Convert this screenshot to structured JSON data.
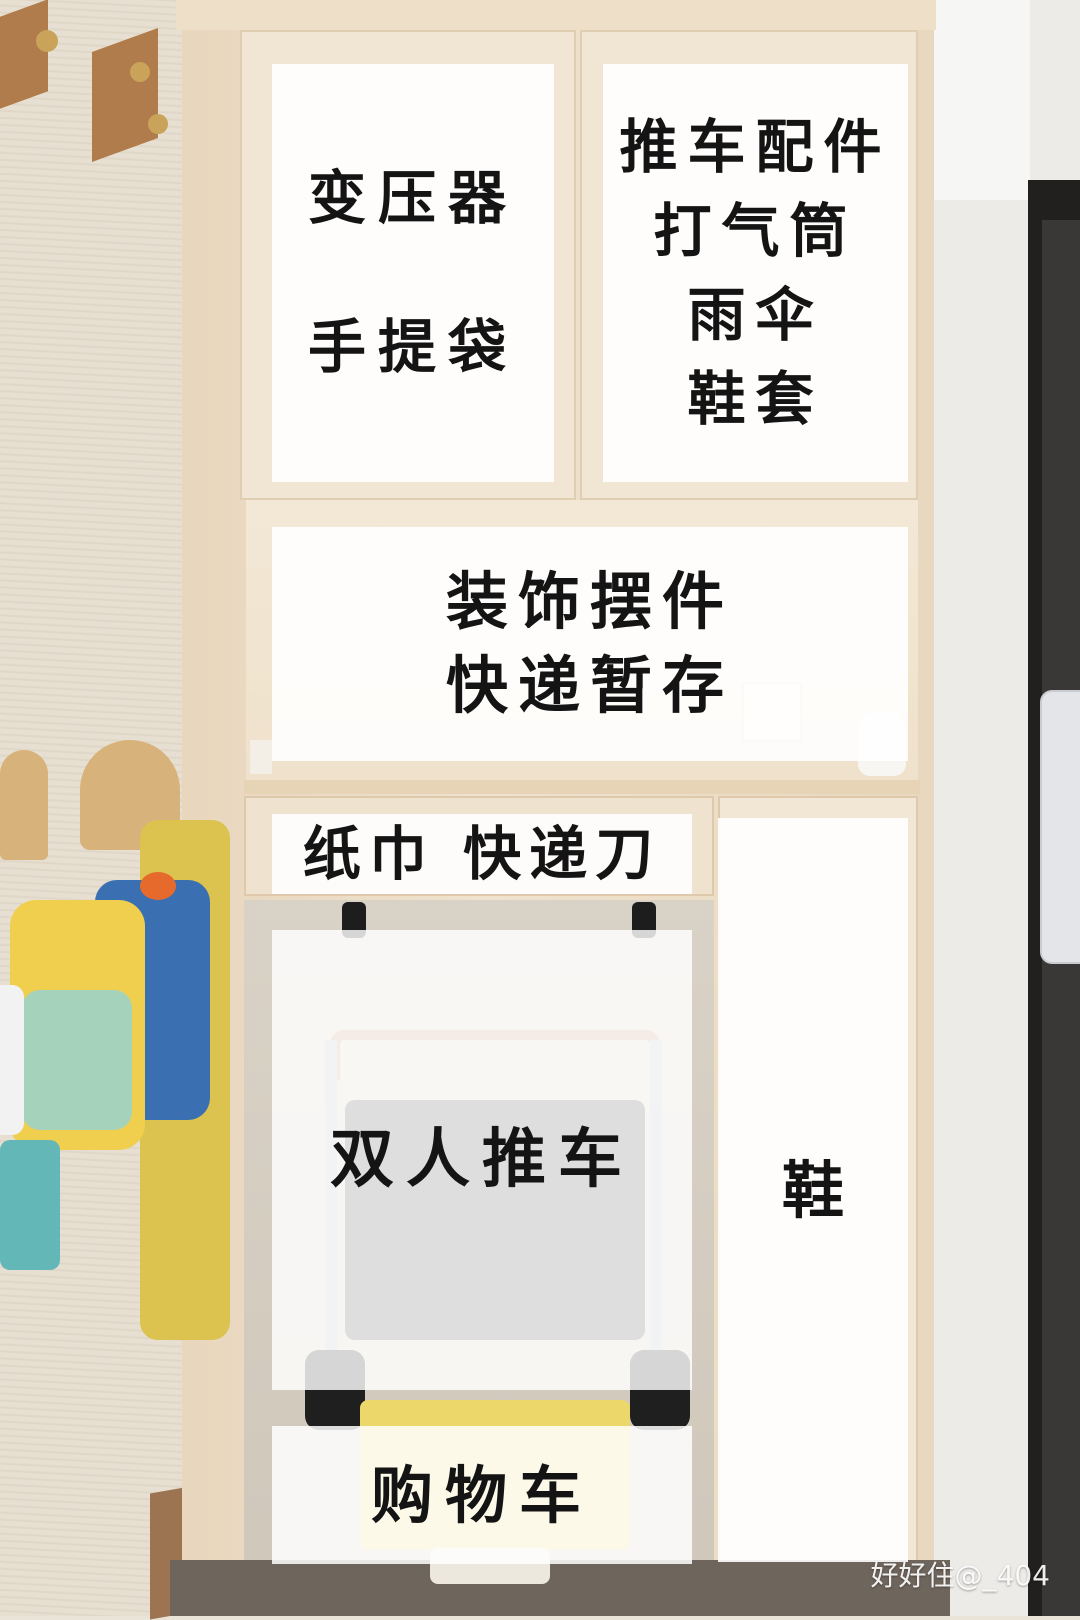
{
  "labels": {
    "upper_left": {
      "line1": "变压器",
      "line2": "手提袋"
    },
    "upper_right": {
      "line1": "推车配件",
      "line2": "打气筒",
      "line3": "雨伞",
      "line4": "鞋套"
    },
    "niche": {
      "line1": "装饰摆件",
      "line2": "快递暂存"
    },
    "drawer": {
      "text": "纸巾 快递刀"
    },
    "stroller_bay": {
      "text": "双人推车"
    },
    "shoe_cabinet": {
      "text": "鞋"
    },
    "bottom": {
      "text": "购物车"
    }
  },
  "watermark": {
    "text": "好好住@_404"
  },
  "colors": {
    "cabinet_wood": "#f0e2cd",
    "label_background": "#ffffff",
    "label_text": "#141414"
  }
}
